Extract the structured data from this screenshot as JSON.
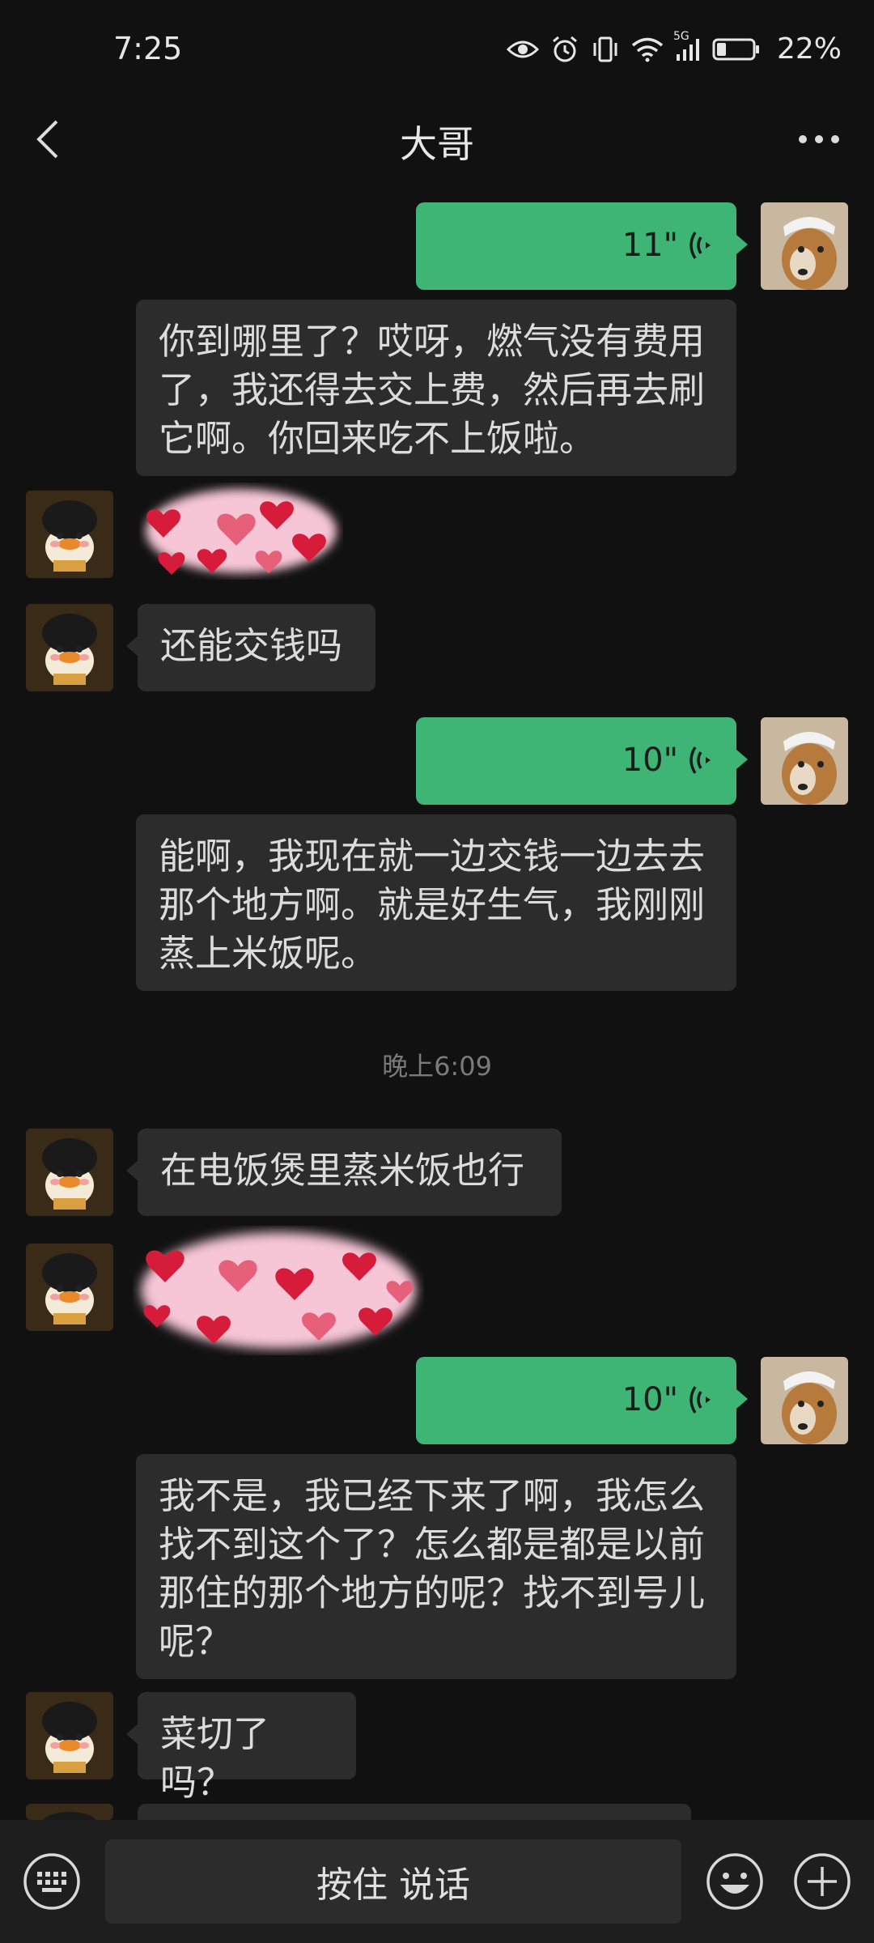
{
  "status_bar": {
    "time": "7:25",
    "battery_percent": "22%",
    "network": "5G",
    "icons": [
      "eye-icon",
      "alarm-icon",
      "vibrate-icon",
      "wifi-icon",
      "signal-icon",
      "battery-icon"
    ]
  },
  "header": {
    "title": "大哥",
    "back_icon": "chevron-left-icon",
    "more_icon": "more-dots-icon"
  },
  "messages": [
    {
      "type": "voice",
      "side": "right",
      "duration": "11\""
    },
    {
      "type": "transcript",
      "text": "你到哪里了？哎呀，燃气没有费用了，我还得去交上费，然后再去刷它啊。你回来吃不上饭啦。"
    },
    {
      "type": "sticker",
      "side": "left",
      "sticker": "hearts-sticker"
    },
    {
      "type": "text",
      "side": "left",
      "text": "还能交钱吗"
    },
    {
      "type": "voice",
      "side": "right",
      "duration": "10\""
    },
    {
      "type": "transcript",
      "text": "能啊，我现在就一边交钱一边去去那个地方啊。就是好生气，我刚刚蒸上米饭呢。"
    },
    {
      "type": "timestamp",
      "text": "晚上6:09"
    },
    {
      "type": "text",
      "side": "left",
      "text": "在电饭煲里蒸米饭也行"
    },
    {
      "type": "sticker",
      "side": "left",
      "sticker": "hearts-sticker"
    },
    {
      "type": "voice",
      "side": "right",
      "duration": "10\""
    },
    {
      "type": "transcript",
      "text": "我不是，我已经下来了啊，我怎么找不到这个了？怎么都是都是以前那住的那个地方的呢？找不到号儿呢？"
    },
    {
      "type": "text",
      "side": "left",
      "text": "菜切了吗？"
    }
  ],
  "bottom_bar": {
    "keyboard_icon": "keyboard-icon",
    "talk_label": "按住 说话",
    "emoji_icon": "emoji-icon",
    "plus_icon": "plus-icon"
  },
  "colors": {
    "background": "#111111",
    "bubble": "#2c2c2c",
    "voice_bubble": "#3eb575",
    "bottom_bar": "#1e1e1e"
  }
}
